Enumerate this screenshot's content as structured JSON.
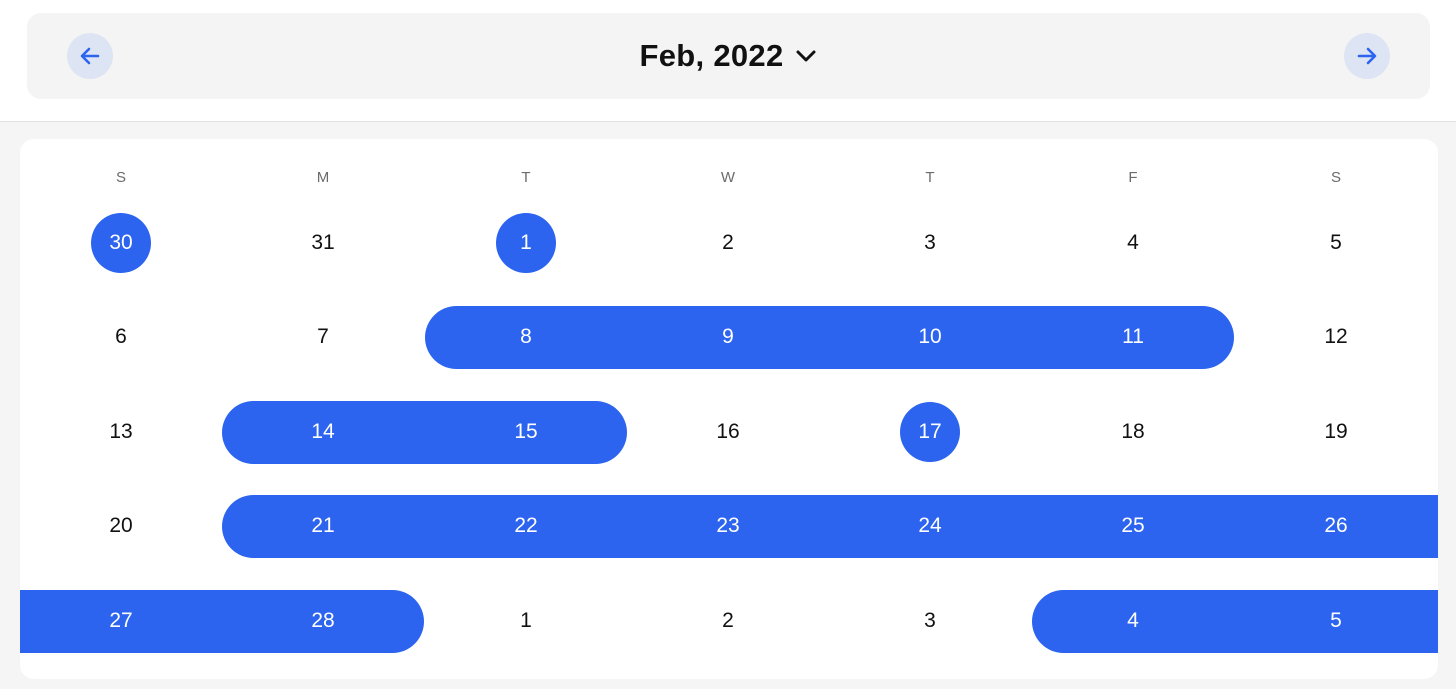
{
  "header": {
    "month_label": "Feb, 2022",
    "prev_icon": "arrow-left-icon",
    "next_icon": "arrow-right-icon",
    "dropdown_icon": "chevron-down-icon"
  },
  "colors": {
    "accent": "#2c64f0",
    "nav_button_bg": "#dde4f3",
    "text": "#111111"
  },
  "weekdays": [
    "S",
    "M",
    "T",
    "W",
    "T",
    "F",
    "S"
  ],
  "weeks": [
    [
      {
        "day": "30",
        "selected": true
      },
      {
        "day": "31",
        "selected": false
      },
      {
        "day": "1",
        "selected": true
      },
      {
        "day": "2",
        "selected": false
      },
      {
        "day": "3",
        "selected": false
      },
      {
        "day": "4",
        "selected": false
      },
      {
        "day": "5",
        "selected": false
      }
    ],
    [
      {
        "day": "6",
        "selected": false
      },
      {
        "day": "7",
        "selected": false
      },
      {
        "day": "8",
        "selected": true
      },
      {
        "day": "9",
        "selected": true
      },
      {
        "day": "10",
        "selected": true
      },
      {
        "day": "11",
        "selected": true
      },
      {
        "day": "12",
        "selected": false
      }
    ],
    [
      {
        "day": "13",
        "selected": false
      },
      {
        "day": "14",
        "selected": true
      },
      {
        "day": "15",
        "selected": true
      },
      {
        "day": "16",
        "selected": false
      },
      {
        "day": "17",
        "selected": true
      },
      {
        "day": "18",
        "selected": false
      },
      {
        "day": "19",
        "selected": false
      }
    ],
    [
      {
        "day": "20",
        "selected": false
      },
      {
        "day": "21",
        "selected": true
      },
      {
        "day": "22",
        "selected": true
      },
      {
        "day": "23",
        "selected": true
      },
      {
        "day": "24",
        "selected": true
      },
      {
        "day": "25",
        "selected": true
      },
      {
        "day": "26",
        "selected": true
      }
    ],
    [
      {
        "day": "27",
        "selected": true
      },
      {
        "day": "28",
        "selected": true
      },
      {
        "day": "1",
        "selected": false
      },
      {
        "day": "2",
        "selected": false
      },
      {
        "day": "3",
        "selected": false
      },
      {
        "day": "4",
        "selected": true
      },
      {
        "day": "5",
        "selected": true
      }
    ]
  ],
  "selected_ranges_note_free": true
}
